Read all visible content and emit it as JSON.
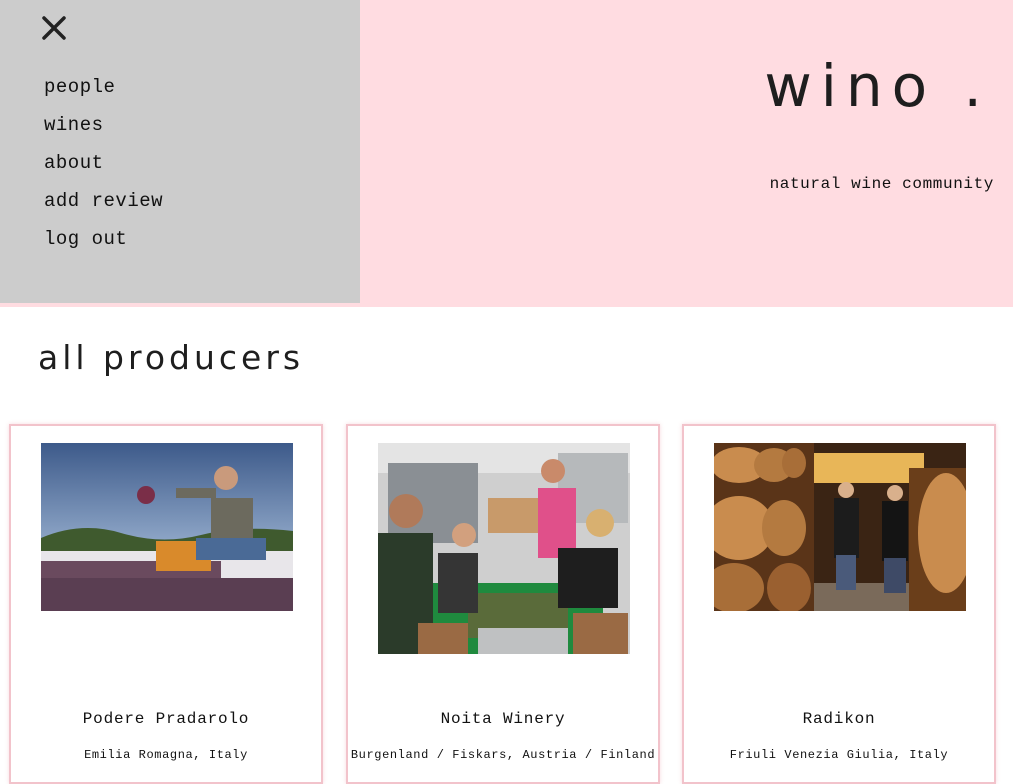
{
  "menu": {
    "items": [
      {
        "label": "people"
      },
      {
        "label": "wines"
      },
      {
        "label": "about"
      },
      {
        "label": "add review"
      },
      {
        "label": "log out"
      }
    ]
  },
  "brand": {
    "logo": "wino .",
    "tagline": "natural wine community"
  },
  "main": {
    "title": "all producers"
  },
  "producers": [
    {
      "name": "Podere Pradarolo",
      "region": "Emilia Romagna, Italy"
    },
    {
      "name": "Noita Winery",
      "region": "Burgenland / Fiskars, Austria / Finland"
    },
    {
      "name": "Radikon",
      "region": "Friuli Venezia Giulia, Italy"
    }
  ],
  "colors": {
    "header_bg": "#ffdce1",
    "menu_bg": "#cccccc",
    "card_border": "#f2c3cb"
  }
}
